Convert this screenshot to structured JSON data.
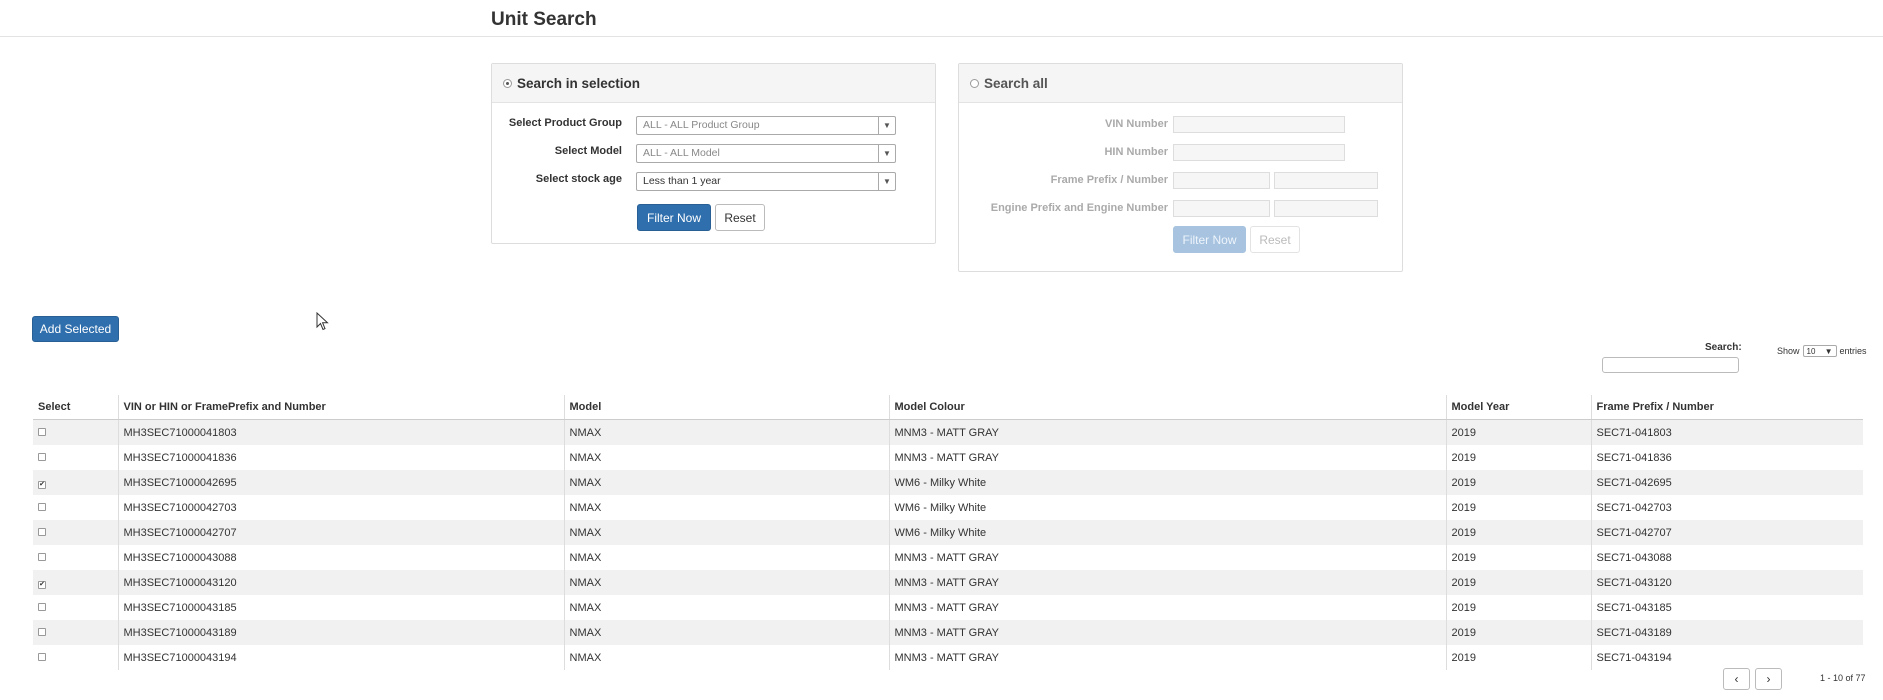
{
  "page": {
    "title": "Unit Search"
  },
  "selection_panel": {
    "title": "Search in selection",
    "product_group_label": "Select Product Group",
    "product_group_value": "ALL - ALL Product Group",
    "model_label": "Select Model",
    "model_value": "ALL - ALL Model",
    "stock_age_label": "Select stock age",
    "stock_age_value": "Less than 1 year",
    "filter_label": "Filter Now",
    "reset_label": "Reset"
  },
  "all_panel": {
    "title": "Search all",
    "vin_label": "VIN Number",
    "hin_label": "HIN Number",
    "frame_label": "Frame Prefix / Number",
    "engine_label": "Engine Prefix and Engine Number",
    "filter_label": "Filter Now",
    "reset_label": "Reset"
  },
  "toolbar": {
    "add_selected_label": "Add Selected"
  },
  "table_controls": {
    "search_label": "Search:",
    "show_label": "Show",
    "page_size": "10",
    "entries_label": "entries"
  },
  "table": {
    "columns": [
      "Select",
      "VIN or HIN or FramePrefix and Number",
      "Model",
      "Model Colour",
      "Model Year",
      "Frame Prefix / Number"
    ],
    "rows": [
      {
        "checked": false,
        "vin": "MH3SEC71000041803",
        "model": "NMAX",
        "colour": "MNM3 - MATT GRAY",
        "year": "2019",
        "frame": "SEC71-041803"
      },
      {
        "checked": false,
        "vin": "MH3SEC71000041836",
        "model": "NMAX",
        "colour": "MNM3 - MATT GRAY",
        "year": "2019",
        "frame": "SEC71-041836"
      },
      {
        "checked": true,
        "vin": "MH3SEC71000042695",
        "model": "NMAX",
        "colour": "WM6 - Milky White",
        "year": "2019",
        "frame": "SEC71-042695"
      },
      {
        "checked": false,
        "vin": "MH3SEC71000042703",
        "model": "NMAX",
        "colour": "WM6 - Milky White",
        "year": "2019",
        "frame": "SEC71-042703"
      },
      {
        "checked": false,
        "vin": "MH3SEC71000042707",
        "model": "NMAX",
        "colour": "WM6 - Milky White",
        "year": "2019",
        "frame": "SEC71-042707"
      },
      {
        "checked": false,
        "vin": "MH3SEC71000043088",
        "model": "NMAX",
        "colour": "MNM3 - MATT GRAY",
        "year": "2019",
        "frame": "SEC71-043088"
      },
      {
        "checked": true,
        "vin": "MH3SEC71000043120",
        "model": "NMAX",
        "colour": "MNM3 - MATT GRAY",
        "year": "2019",
        "frame": "SEC71-043120"
      },
      {
        "checked": false,
        "vin": "MH3SEC71000043185",
        "model": "NMAX",
        "colour": "MNM3 - MATT GRAY",
        "year": "2019",
        "frame": "SEC71-043185"
      },
      {
        "checked": false,
        "vin": "MH3SEC71000043189",
        "model": "NMAX",
        "colour": "MNM3 - MATT GRAY",
        "year": "2019",
        "frame": "SEC71-043189"
      },
      {
        "checked": false,
        "vin": "MH3SEC71000043194",
        "model": "NMAX",
        "colour": "MNM3 - MATT GRAY",
        "year": "2019",
        "frame": "SEC71-043194"
      }
    ]
  },
  "pagination": {
    "prev_icon": "‹",
    "next_icon": "›",
    "info": "1 - 10 of 77"
  },
  "colors": {
    "primary": "#2f6fad",
    "stripe": "#f1f1f1"
  }
}
